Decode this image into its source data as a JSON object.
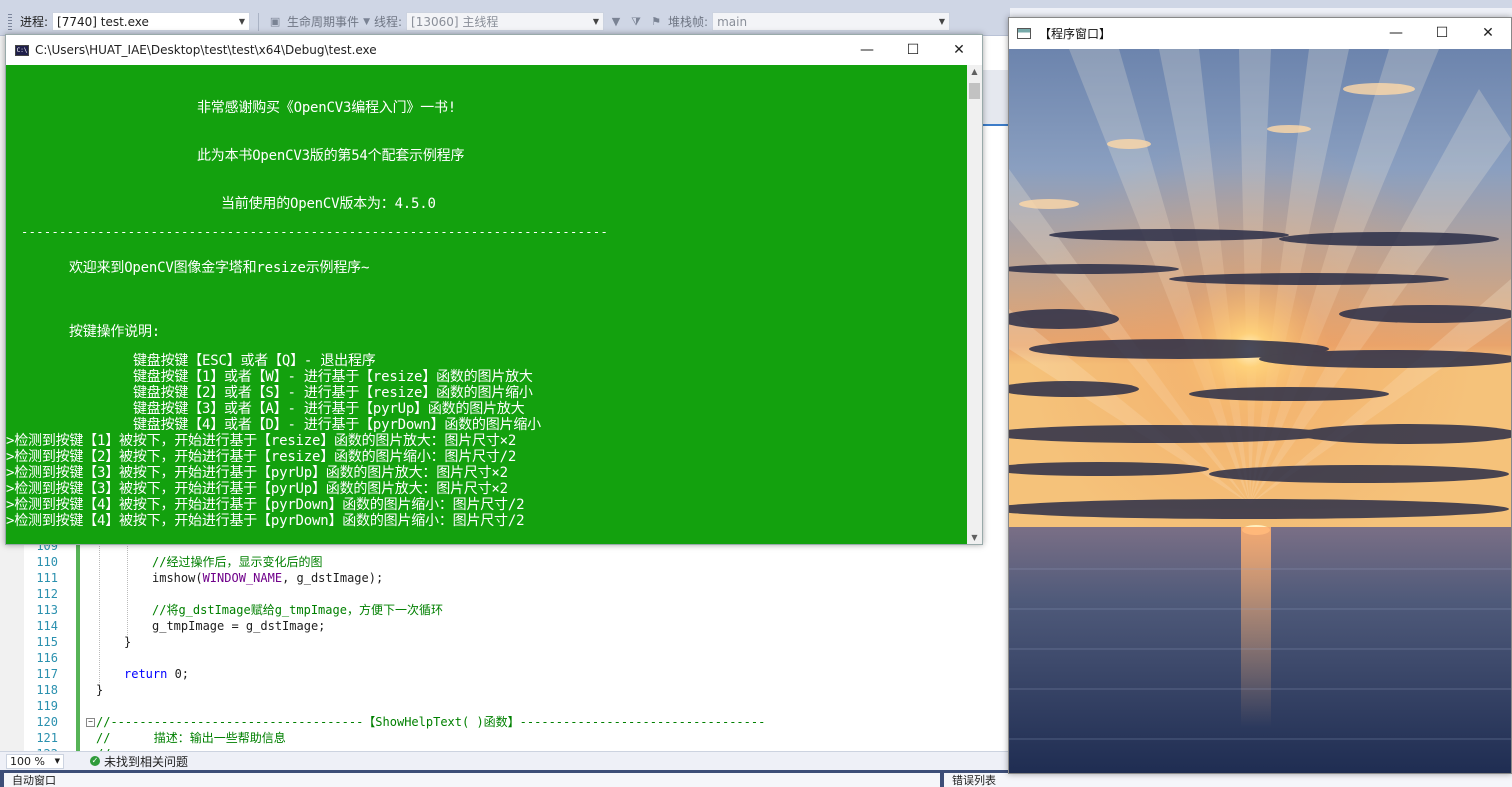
{
  "vs_toolbar": {
    "process_label": "进程:",
    "process_value": "[7740] test.exe",
    "lifecycle_label": "生命周期事件",
    "thread_label": "线程:",
    "thread_value": "[13060] 主线程",
    "stack_label": "堆栈帧:",
    "stack_value": "main"
  },
  "console": {
    "title": "C:\\Users\\HUAT_IAE\\Desktop\\test\\test\\x64\\Debug\\test.exe",
    "icon": "cmd-icon",
    "background": "#13a10e",
    "header_lines": [
      "非常感谢购买《OpenCV3编程入门》一书!",
      "此为本书OpenCV3版的第54个配套示例程序",
      "当前使用的OpenCV版本为：4.5.0"
    ],
    "divider": "-----------------------------------------------------------------------------",
    "welcome": "欢迎来到OpenCV图像金字塔和resize示例程序~",
    "keys_title": "按键操作说明:",
    "keys": [
      "键盘按键【ESC】或者【Q】- 退出程序",
      "键盘按键【1】或者【W】- 进行基于【resize】函数的图片放大",
      "键盘按键【2】或者【S】- 进行基于【resize】函数的图片缩小",
      "键盘按键【3】或者【A】- 进行基于【pyrUp】函数的图片放大",
      "键盘按键【4】或者【D】- 进行基于【pyrDown】函数的图片缩小"
    ],
    "log": [
      ">检测到按键【1】被按下，开始进行基于【resize】函数的图片放大：图片尺寸×2",
      ">检测到按键【2】被按下，开始进行基于【resize】函数的图片缩小：图片尺寸/2",
      ">检测到按键【3】被按下，开始进行基于【pyrUp】函数的图片放大：图片尺寸×2",
      ">检测到按键【3】被按下，开始进行基于【pyrUp】函数的图片放大：图片尺寸×2",
      ">检测到按键【4】被按下，开始进行基于【pyrDown】函数的图片缩小：图片尺寸/2",
      ">检测到按键【4】被按下，开始进行基于【pyrDown】函数的图片缩小：图片尺寸/2"
    ]
  },
  "image_window": {
    "title": "【程序窗口】"
  },
  "editor": {
    "lines": [
      {
        "n": "109",
        "code": ""
      },
      {
        "n": "110",
        "code": "//经过操作后，显示变化后的图",
        "kind": "comment"
      },
      {
        "n": "111",
        "pre": "imshow(",
        "macro": "WINDOW_NAME",
        "post": ", g_dstImage);",
        "kind": "call"
      },
      {
        "n": "112",
        "code": ""
      },
      {
        "n": "113",
        "code": "//将g_dstImage赋给g_tmpImage，方便下一次循环",
        "kind": "comment"
      },
      {
        "n": "114",
        "code": "g_tmpImage = g_dstImage;",
        "kind": "text"
      },
      {
        "n": "115",
        "code": "}",
        "kind": "text"
      },
      {
        "n": "116",
        "code": ""
      },
      {
        "n": "117",
        "kw": "return",
        "post": " 0;",
        "kind": "return"
      },
      {
        "n": "118",
        "code": "}",
        "kind": "text"
      },
      {
        "n": "119",
        "code": ""
      },
      {
        "n": "120",
        "code": "//-----------------------------------【ShowHelpText( )函数】----------------------------------",
        "kind": "comment"
      },
      {
        "n": "121",
        "code": "//      描述：输出一些帮助信息",
        "kind": "comment"
      },
      {
        "n": "122",
        "code": "//",
        "kind": "comment"
      }
    ]
  },
  "status": {
    "zoom": "100 %",
    "issues": "未找到相关问题"
  },
  "bottom": {
    "left_tab": "自动窗口",
    "right_tab": "错误列表"
  }
}
